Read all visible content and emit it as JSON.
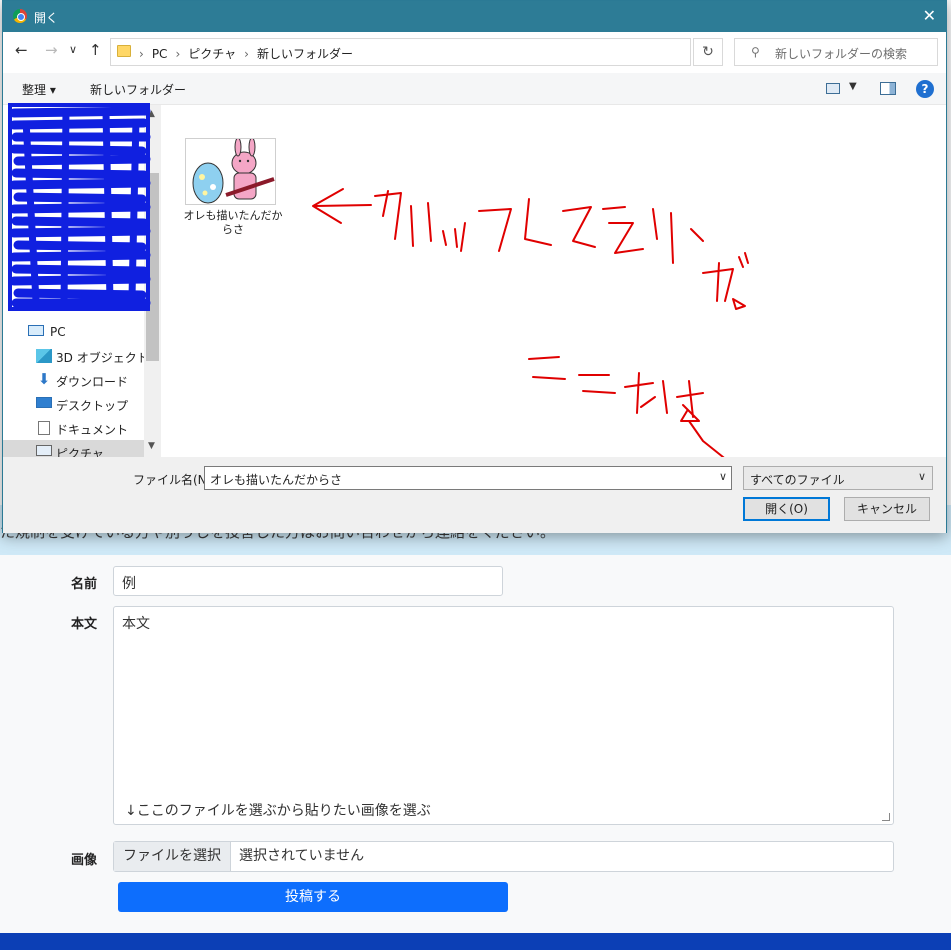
{
  "dialog": {
    "title": "開く",
    "close": "✕",
    "nav": {
      "back": "←",
      "forward": "→",
      "down": "∨",
      "up": "↑"
    },
    "breadcrumb": [
      "PC",
      "ピクチャ",
      "新しいフォルダー"
    ],
    "address_dropdown": "∨",
    "refresh": "↻",
    "search_placeholder": "新しいフォルダーの検索",
    "toolbar": {
      "organize": "整理 ▾",
      "new_folder": "新しいフォルダー",
      "help": "?"
    },
    "nav_pane": [
      {
        "label": "PC",
        "icon": "pc-icon"
      },
      {
        "label": "3D オブジェクト",
        "icon": "3d-objects-icon"
      },
      {
        "label": "ダウンロード",
        "icon": "download-icon"
      },
      {
        "label": "デスクトップ",
        "icon": "desktop-icon"
      },
      {
        "label": "ドキュメント",
        "icon": "documents-icon"
      },
      {
        "label": "ピクチャ",
        "icon": "pictures-icon",
        "selected": true
      }
    ],
    "file": {
      "name_line1": "オレも描いたんだか",
      "name_line2": "らさ"
    },
    "footer": {
      "filename_label": "ファイル名(N):",
      "filename_value": "オレも描いたんだからさ",
      "filetype": "すべてのファイル",
      "open_button": "開く(O)",
      "cancel_button": "キャンセル"
    },
    "handwriting": {
      "main": "←クリックしてえらぶ",
      "secondary": "ここおす"
    }
  },
  "page": {
    "notice": "た規制を受けている方や別うしを投害した方はお問い合わせから連絡をください。",
    "name_label": "名前",
    "name_value": "例",
    "body_label": "本文",
    "body_value": "本文",
    "body_note": "↓ここのファイルを選ぶから貼りたい画像を選ぶ",
    "image_label": "画像",
    "file_button": "ファイルを選択",
    "file_status": "選択されていません",
    "submit": "投稿する"
  },
  "colors": {
    "titlebar": "#2d7c96",
    "submit": "#0d6efd",
    "annotation_red": "#e00000",
    "redaction_blue": "#1020e0"
  }
}
